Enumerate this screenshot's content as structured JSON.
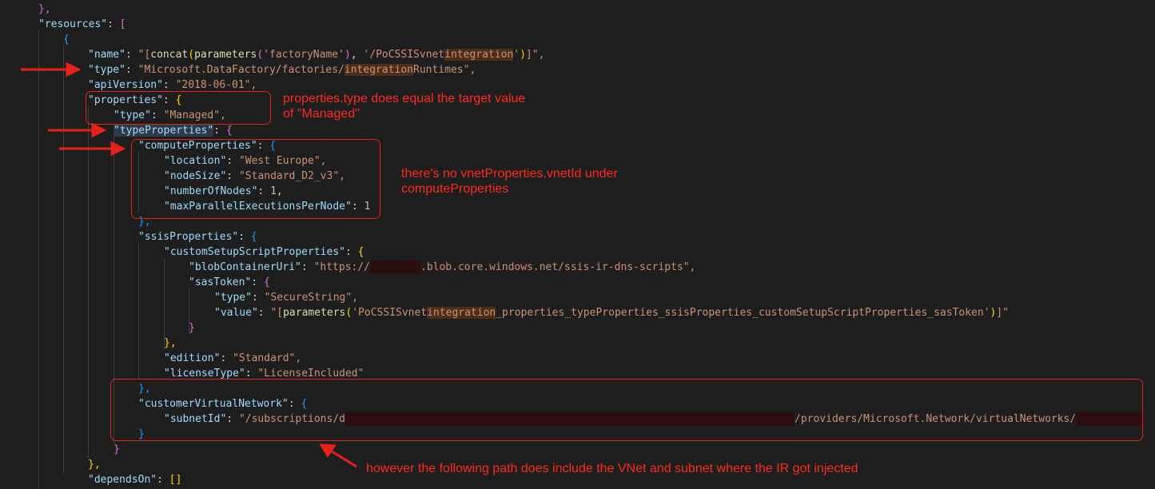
{
  "code": {
    "l0_close": "},",
    "resources_key": "\"resources\"",
    "colon_sp": ": ",
    "lbracket": "[",
    "lbrace": "{",
    "name_key": "\"name\"",
    "name_val_a": "\"[",
    "name_concat": "concat",
    "name_paren1": "(",
    "name_params": "parameters",
    "name_paren2": "(",
    "name_arg1": "'factoryName'",
    "name_paren3": ")",
    "name_comma": ", ",
    "name_arg2a": "'/PoCSSISvnet",
    "name_arg2b": "integration",
    "name_arg2c": "'",
    "name_paren4": ")",
    "name_end": "]\",",
    "type_key": "\"type\"",
    "type_val_a": "\"Microsoft.DataFactory/factories/",
    "type_val_b": "integration",
    "type_val_c": "Runtimes\",",
    "api_key": "\"apiVersion\"",
    "api_val": "\"2018-06-01\",",
    "props_key": "\"properties\"",
    "ptype_key": "\"type\"",
    "ptype_val": "\"Managed\",",
    "tp_key": "\"typeProperties\"",
    "cp_key": "\"computeProperties\"",
    "loc_key": "\"location\"",
    "loc_val": "\"West Europe\",",
    "ns_key": "\"nodeSize\"",
    "ns_val": "\"Standard_D2_v3\",",
    "non_key": "\"numberOfNodes\"",
    "non_val": "1",
    "comma": ",",
    "mpe_key": "\"maxParallelExecutionsPerNode\"",
    "mpe_val": "1",
    "close_brace_comma": "},",
    "close_brace": "}",
    "ssis_key": "\"ssisProperties\"",
    "cssp_key": "\"customSetupScriptProperties\"",
    "blob_key": "\"blobContainerUri\"",
    "blob_val_a": "\"https://",
    "blob_val_b": ".blob.core.windows.net/ssis-ir-dns-scripts\",",
    "sas_key": "\"sasToken\"",
    "sas_type_key": "\"type\"",
    "sas_type_val": "\"SecureString\",",
    "value_key": "\"value\"",
    "value_a": "\"[",
    "value_params": "parameters",
    "value_paren": "(",
    "value_str_a": "'PoCSSISvnet",
    "value_str_b": "integration",
    "value_str_c": "_properties_typeProperties_ssisProperties_customSetupScriptProperties_sasToken'",
    "value_paren2": ")",
    "value_end": "]\"",
    "edition_key": "\"edition\"",
    "edition_val": "\"Standard\",",
    "lic_key": "\"licenseType\"",
    "lic_val": "\"LicenseIncluded\"",
    "cvn_key": "\"customerVirtualNetwork\"",
    "subnet_key": "\"subnetId\"",
    "subnet_val_a": "\"/subscriptions/d",
    "subnet_val_b": "/providers/Microsoft.Network/virtualNetworks/",
    "depends_key": "\"dependsOn\"",
    "depends_val": "[]"
  },
  "annotations": {
    "note1": "properties.type does equal the target value\nof \"Managed\"",
    "note2": "there's no vnetProperties.vnetId under\ncomputeProperties",
    "note3": "however the following path does include the VNet and subnet where the IR got injected"
  },
  "colors": {
    "background": "#1e1e1e",
    "annotation_red": "#ff2a1f",
    "json_key": "#9cdcfe",
    "json_string": "#ce9178",
    "json_number": "#b5cea8"
  }
}
